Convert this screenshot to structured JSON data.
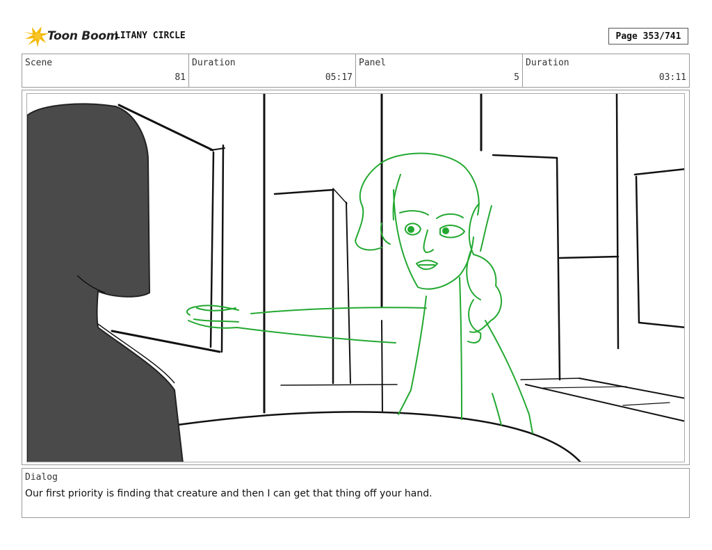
{
  "header": {
    "logo_text": "Toon Boom",
    "project_title": "LITANY CIRCLE",
    "page_indicator": "Page 353/741"
  },
  "info": {
    "scene_label": "Scene",
    "scene_value": "81",
    "scene_duration_label": "Duration",
    "scene_duration_value": "05:17",
    "panel_label": "Panel",
    "panel_value": "5",
    "panel_duration_label": "Duration",
    "panel_duration_value": "03:11"
  },
  "dialog": {
    "label": "Dialog",
    "text": "Our first priority is finding that creature and then I can get that thing off your hand."
  },
  "colors": {
    "sketch_green": "#22a830",
    "silhouette": "#4a4a4a",
    "logo_yellow": "#f5b800"
  }
}
